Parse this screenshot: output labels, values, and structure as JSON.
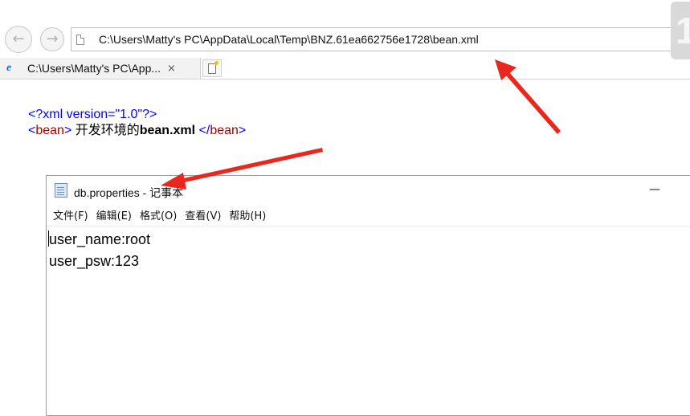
{
  "browser": {
    "address": "C:\\Users\\Matty's PC\\AppData\\Local\\Temp\\BNZ.61ea662756e1728\\bean.xml",
    "tab_title": "C:\\Users\\Matty's PC\\App...",
    "tab_close": "×",
    "corner_char": "1"
  },
  "xml": {
    "decl": "<?xml version=\"1.0\"?>",
    "open_lt": "<",
    "tag": "bean",
    "open_gt": ">",
    "text": " 开发环境的",
    "bold_text": "bean.xml",
    "close_lt": " </",
    "close_tag": "bean",
    "close_gt": ">"
  },
  "notepad": {
    "title": "db.properties - 记事本",
    "minimize": "—",
    "menus": [
      "文件(F)",
      "编辑(E)",
      "格式(O)",
      "查看(V)",
      "帮助(H)"
    ],
    "lines": [
      "user_name:root",
      "user_psw:123"
    ]
  },
  "annotations": {
    "arrow_color": "#e8281f"
  },
  "icons": [
    "back-icon",
    "forward-icon",
    "page-icon",
    "ie-icon",
    "new-tab-icon",
    "notepad-icon"
  ]
}
